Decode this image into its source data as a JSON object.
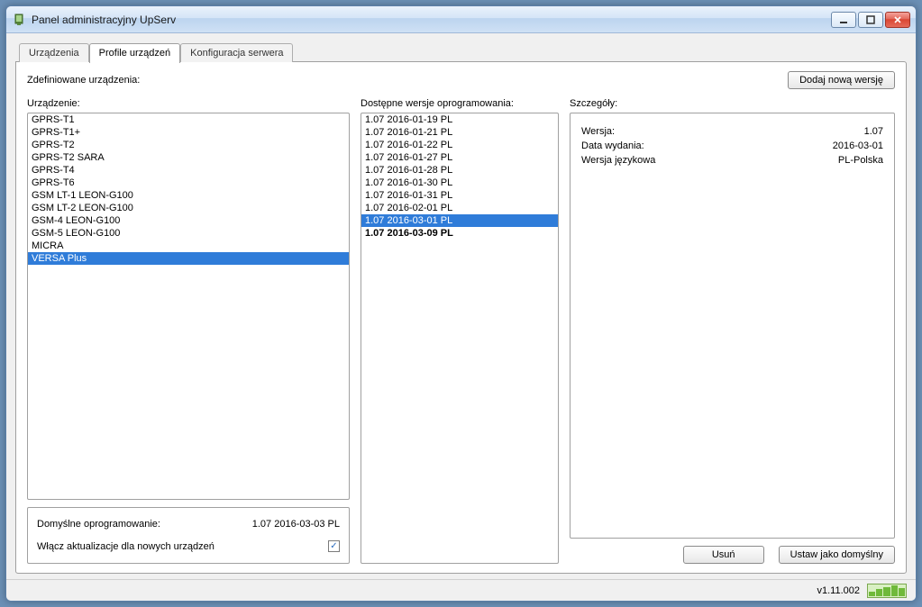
{
  "window": {
    "title": "Panel administracyjny UpServ"
  },
  "tabs": [
    {
      "label": "Urządzenia",
      "active": false
    },
    {
      "label": "Profile urządzeń",
      "active": true
    },
    {
      "label": "Konfiguracja serwera",
      "active": false
    }
  ],
  "labels": {
    "defined_devices": "Zdefiniowane urządzenia:",
    "devices_col": "Urządzenie:",
    "versions_col": "Dostępne wersje oprogramowania:",
    "details_col": "Szczegóły:",
    "add_version_btn": "Dodaj nową wersję",
    "default_software": "Domyślne oprogramowanie:",
    "default_software_value": "1.07 2016-03-03 PL",
    "enable_updates": "Włącz aktualizacje dla nowych urządzeń",
    "delete_btn": "Usuń",
    "set_default_btn": "Ustaw jako domyślny",
    "detail_version_label": "Wersja:",
    "detail_date_label": "Data wydania:",
    "detail_lang_label": "Wersja językowa"
  },
  "devices": [
    {
      "name": "GPRS-T1",
      "selected": false
    },
    {
      "name": "GPRS-T1+",
      "selected": false
    },
    {
      "name": "GPRS-T2",
      "selected": false
    },
    {
      "name": "GPRS-T2 SARA",
      "selected": false
    },
    {
      "name": "GPRS-T4",
      "selected": false
    },
    {
      "name": "GPRS-T6",
      "selected": false
    },
    {
      "name": "GSM LT-1 LEON-G100",
      "selected": false
    },
    {
      "name": "GSM LT-2 LEON-G100",
      "selected": false
    },
    {
      "name": "GSM-4 LEON-G100",
      "selected": false
    },
    {
      "name": "GSM-5 LEON-G100",
      "selected": false
    },
    {
      "name": "MICRA",
      "selected": false
    },
    {
      "name": "VERSA Plus",
      "selected": true
    }
  ],
  "versions": [
    {
      "name": "1.07 2016-01-19 PL",
      "selected": false,
      "bold": false
    },
    {
      "name": "1.07 2016-01-21 PL",
      "selected": false,
      "bold": false
    },
    {
      "name": "1.07 2016-01-22 PL",
      "selected": false,
      "bold": false
    },
    {
      "name": "1.07 2016-01-27 PL",
      "selected": false,
      "bold": false
    },
    {
      "name": "1.07 2016-01-28 PL",
      "selected": false,
      "bold": false
    },
    {
      "name": "1.07 2016-01-30 PL",
      "selected": false,
      "bold": false
    },
    {
      "name": "1.07 2016-01-31 PL",
      "selected": false,
      "bold": false
    },
    {
      "name": "1.07 2016-02-01 PL",
      "selected": false,
      "bold": false
    },
    {
      "name": "1.07 2016-03-01 PL",
      "selected": true,
      "bold": false
    },
    {
      "name": "1.07 2016-03-09 PL",
      "selected": false,
      "bold": true
    }
  ],
  "details": {
    "version": "1.07",
    "date": "2016-03-01",
    "lang": "PL-Polska"
  },
  "enable_updates_checked": true,
  "statusbar": {
    "version": "v1.11.002"
  }
}
